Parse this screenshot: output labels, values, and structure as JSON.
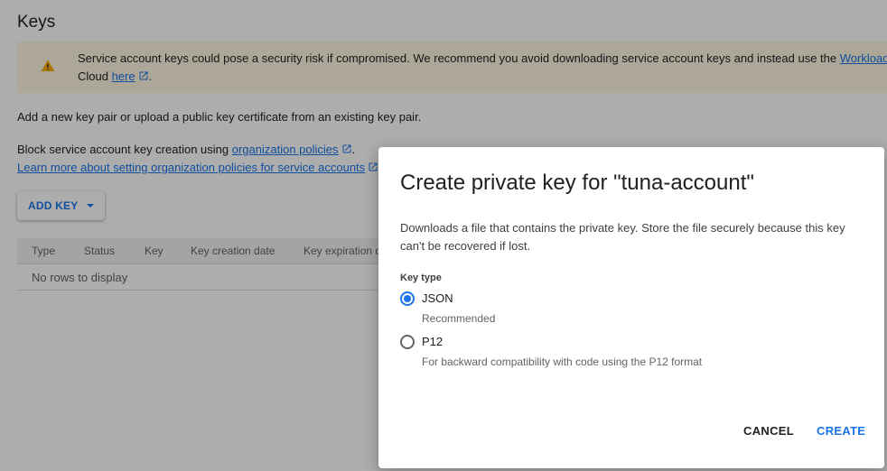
{
  "page": {
    "title": "Keys",
    "banner": {
      "icon": "warning-icon",
      "text_line1": "Service account keys could pose a security risk if compromised. We recommend you avoid downloading service account keys and instead use the ",
      "link_workload": "Workload",
      "text_line2_prefix": "Cloud ",
      "link_here": "here",
      "text_line2_suffix": "."
    },
    "description": "Add a new key pair or upload a public key certificate from an existing key pair.",
    "block_text": "Block service account key creation using ",
    "block_link": "organization policies",
    "block_suffix": ".",
    "learn_more_link": "Learn more about setting organization policies for service accounts",
    "add_key_label": "ADD KEY",
    "table": {
      "columns": [
        "Type",
        "Status",
        "Key",
        "Key creation date",
        "Key expiration d"
      ],
      "empty_text": "No rows to display"
    }
  },
  "dialog": {
    "title": "Create private key for \"tuna-account\"",
    "body": "Downloads a file that contains the private key. Store the file securely because this key can't be recovered if lost.",
    "key_type_label": "Key type",
    "options": [
      {
        "label": "JSON",
        "sublabel": "Recommended",
        "selected": true
      },
      {
        "label": "P12",
        "sublabel": "For backward compatibility with code using the P12 format",
        "selected": false
      }
    ],
    "cancel_label": "CANCEL",
    "create_label": "CREATE"
  },
  "colors": {
    "accent": "#1a73e8",
    "warning": "#f9ab00",
    "banner_bg": "#fef7e0"
  }
}
